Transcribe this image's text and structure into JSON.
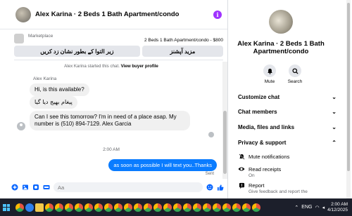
{
  "chat": {
    "title": "Alex Karina · 2 Beds 1 Bath Apartment/condo",
    "marketplace_label": "Marketplace",
    "listing": "2 Beds 1 Bath Apartment/condo - $800",
    "action_left": "مزید آپشنز",
    "action_right": "زیر التوا کے بطور نشان زد کریں",
    "started_text": "Alex Karina started this chat.",
    "view_profile": "View buyer profile",
    "sender_name": "Alex Karina",
    "messages": [
      "Hi, is this available?",
      "پیغام بھیج دیا گیا",
      "Can I see this tomorrow? I'm in need of a place asap. My number is (510) 894-7129. Alex Garcia"
    ],
    "timestamp": "2:00 AM",
    "outgoing": "as soon as possible I will text you..Thanks",
    "sent_label": "Sent",
    "input_placeholder": "Aa"
  },
  "panel": {
    "title": "Alex Karina · 2 Beds 1 Bath Apartment/condo",
    "mute_label": "Mute",
    "search_label": "Search",
    "sections": [
      "Customize chat",
      "Chat members",
      "Media, files and links",
      "Privacy & support"
    ],
    "options": [
      {
        "label": "Mute notifications",
        "sub": ""
      },
      {
        "label": "Read receipts",
        "sub": "On"
      },
      {
        "label": "Report",
        "sub": "Give feedback and report the"
      }
    ]
  },
  "taskbar": {
    "time": "2:00 AM",
    "date": "4/12/2025",
    "lang": "ENG",
    "app_colors": [
      "#e8543f",
      "#2f80ed",
      "#f2c94c",
      "#e8543f",
      "#e8543f",
      "#e8543f",
      "#e8543f",
      "#e8543f",
      "#e8543f",
      "#e8543f",
      "#e8543f",
      "#e8543f",
      "#e8543f",
      "#e8543f",
      "#e8543f",
      "#e8543f",
      "#e8543f",
      "#e8543f",
      "#e8543f",
      "#e8543f",
      "#e8543f",
      "#e8543f",
      "#e8543f",
      "#e8543f",
      "#e8543f"
    ]
  },
  "colors": {
    "accent": "#0a7cff",
    "info": "#a033ff"
  }
}
